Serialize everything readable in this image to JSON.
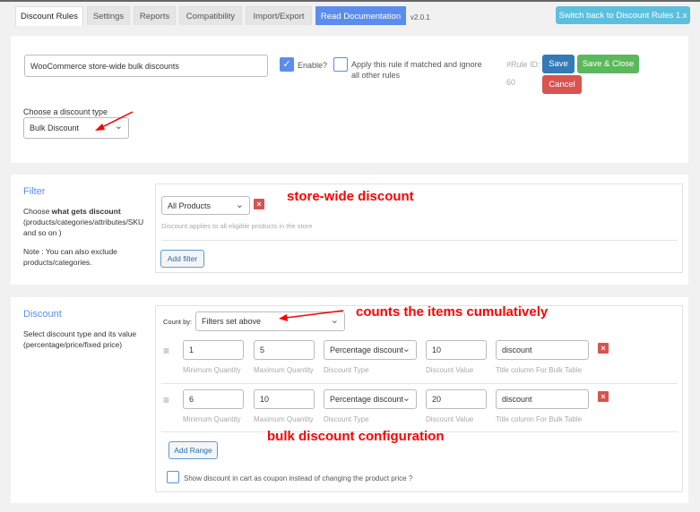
{
  "tabs": [
    {
      "label": "Discount Rules",
      "active": true
    },
    {
      "label": "Settings"
    },
    {
      "label": "Reports"
    },
    {
      "label": "Compatibility"
    },
    {
      "label": "Import/Export"
    },
    {
      "label": "Read Documentation"
    }
  ],
  "version": "v2.0.1",
  "switch_back": "Switch back to Discount Rules 1.x",
  "rule": {
    "name": "WooCommerce store-wide bulk discounts",
    "enable_label": "Enable?",
    "enabled": true,
    "apply_label": "Apply this rule if matched and ignore all other rules",
    "apply_checked": false,
    "rule_id_label": "#Rule ID:",
    "rule_id": "60",
    "save": "Save",
    "save_close": "Save & Close",
    "cancel": "Cancel",
    "discount_type_label": "Choose a discount type",
    "discount_type": "Bulk Discount"
  },
  "filter": {
    "title": "Filter",
    "desc_prefix": "Choose ",
    "desc_bold": "what gets discount",
    "desc_rest": " (products/categories/attributes/SKU and so on )",
    "note": "Note : You can also exclude products/categories.",
    "select": "All Products",
    "remove": "×",
    "help": "Discount applies to all eligible products in the store",
    "add": "Add filter",
    "annotation": "store-wide discount"
  },
  "discount": {
    "title": "Discount",
    "desc": "Select discount type and its value (percentage/price/fixed price)",
    "count_by_label": "Count by:",
    "count_by": "Filters set above",
    "annotation_count": "counts the items cumulatively",
    "annotation_bulk": "bulk discount configuration",
    "labels": {
      "min": "Minimum Quantity",
      "max": "Maximum Quantity",
      "type": "Discount Type",
      "value": "Discount Value",
      "title": "Title column For Bulk Table"
    },
    "ranges": [
      {
        "min": "1",
        "max": "5",
        "type": "Percentage discount",
        "value": "10",
        "title": "discount"
      },
      {
        "min": "6",
        "max": "10",
        "type": "Percentage discount",
        "value": "20",
        "title": "discount"
      }
    ],
    "remove": "×",
    "add_range": "Add Range",
    "coupon_label": "Show discount in cart as coupon instead of changing the product price ?",
    "coupon_checked": false
  },
  "colors": {
    "primary": "#337ab7",
    "success": "#5cb85c",
    "danger": "#d9534f",
    "info": "#5bc0de",
    "doc": "#5b8def",
    "annotation": "#ff0000"
  }
}
